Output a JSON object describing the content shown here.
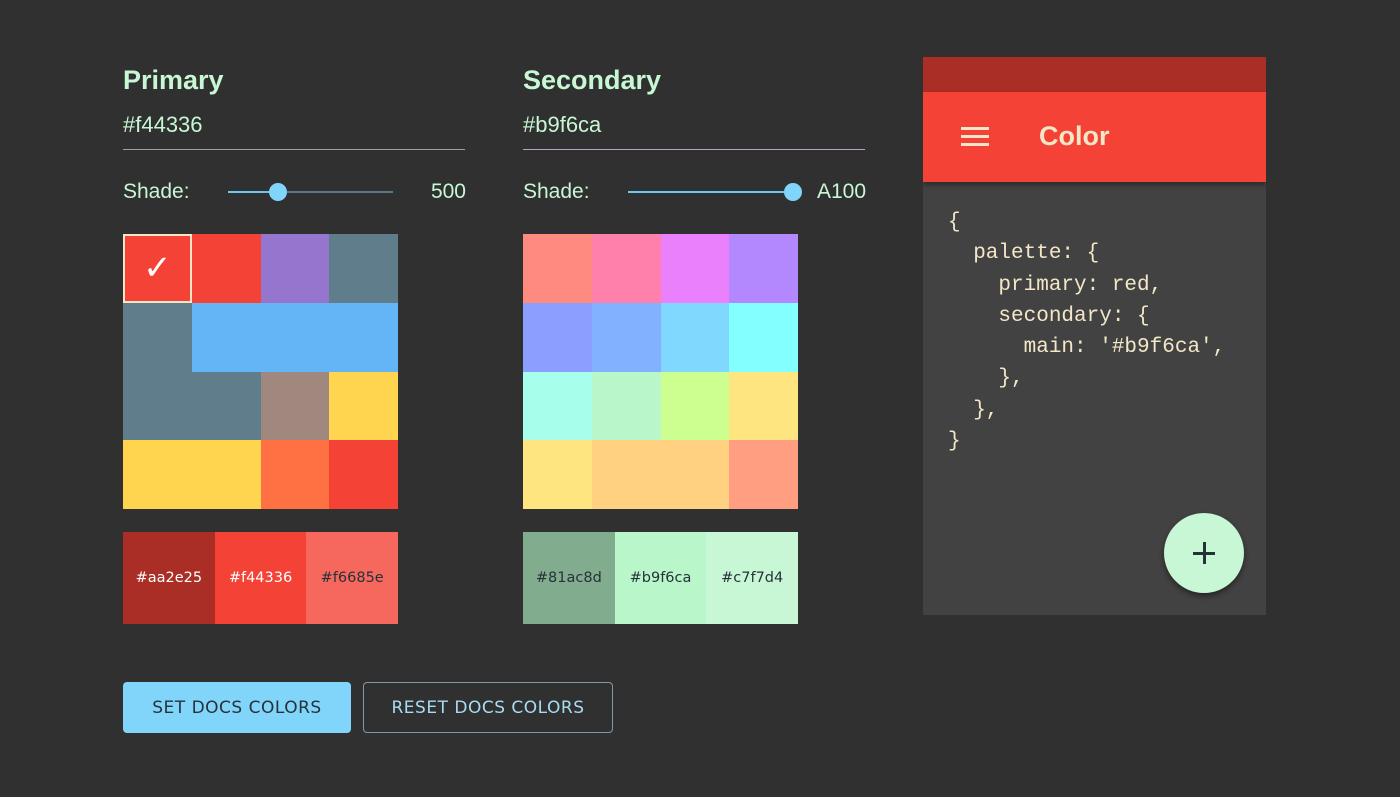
{
  "primary": {
    "title": "Primary",
    "hex_value": "#f44336",
    "shade_label": "Shade:",
    "shade_value": "500",
    "slider_fraction": 0.3,
    "selected_swatch_color": "#f44336",
    "swatches": [
      "#f44336",
      "#f44336",
      "#9575cd",
      "#607d8b",
      "#607d8b",
      "#64b5f6",
      "#64b5f6",
      "#64b5f6",
      "#607d8b",
      "#607d8b",
      "#a1887f",
      "#ffd54f",
      "#ffd54f",
      "#ffd54f",
      "#ff7043",
      "#f44336"
    ],
    "tones": [
      {
        "label": "#aa2e25",
        "bg": "#aa2e25",
        "fg": "#ffffff"
      },
      {
        "label": "#f44336",
        "bg": "#f44336",
        "fg": "#ffffff"
      },
      {
        "label": "#f6685e",
        "bg": "#f6685e",
        "fg": "#26323a"
      }
    ]
  },
  "secondary": {
    "title": "Secondary",
    "hex_value": "#b9f6ca",
    "shade_label": "Shade:",
    "shade_value": "A100",
    "slider_fraction": 1.0,
    "swatches": [
      "#ff8a80",
      "#ff80ab",
      "#ea80fc",
      "#b388ff",
      "#8c9eff",
      "#82b1ff",
      "#80d8ff",
      "#84ffff",
      "#a7ffeb",
      "#b9f6ca",
      "#ccff90",
      "#ffe57f",
      "#ffe57f",
      "#ffd180",
      "#ffd180",
      "#ff9e80"
    ],
    "tones": [
      {
        "label": "#81ac8d",
        "bg": "#81ac8d",
        "fg": "#26323a"
      },
      {
        "label": "#b9f6ca",
        "bg": "#b9f6ca",
        "fg": "#26323a"
      },
      {
        "label": "#c7f7d4",
        "bg": "#c7f7d4",
        "fg": "#26323a"
      }
    ]
  },
  "buttons": {
    "set_label": "SET DOCS COLORS",
    "reset_label": "RESET DOCS COLORS"
  },
  "preview": {
    "app_title": "Color",
    "menu_icon": "hamburger-menu-icon",
    "fab_icon": "plus-icon",
    "code_lines": [
      "{",
      "  palette: {",
      "    primary: red,",
      "    secondary: {",
      "      main: '#b9f6ca',",
      "    },",
      "  },",
      "}"
    ]
  },
  "colors": {
    "background": "#303030",
    "accent_text": "#c7f7d4",
    "status_bar": "#aa2e25",
    "app_bar": "#f44336",
    "button_fill": "#81d4fa"
  }
}
